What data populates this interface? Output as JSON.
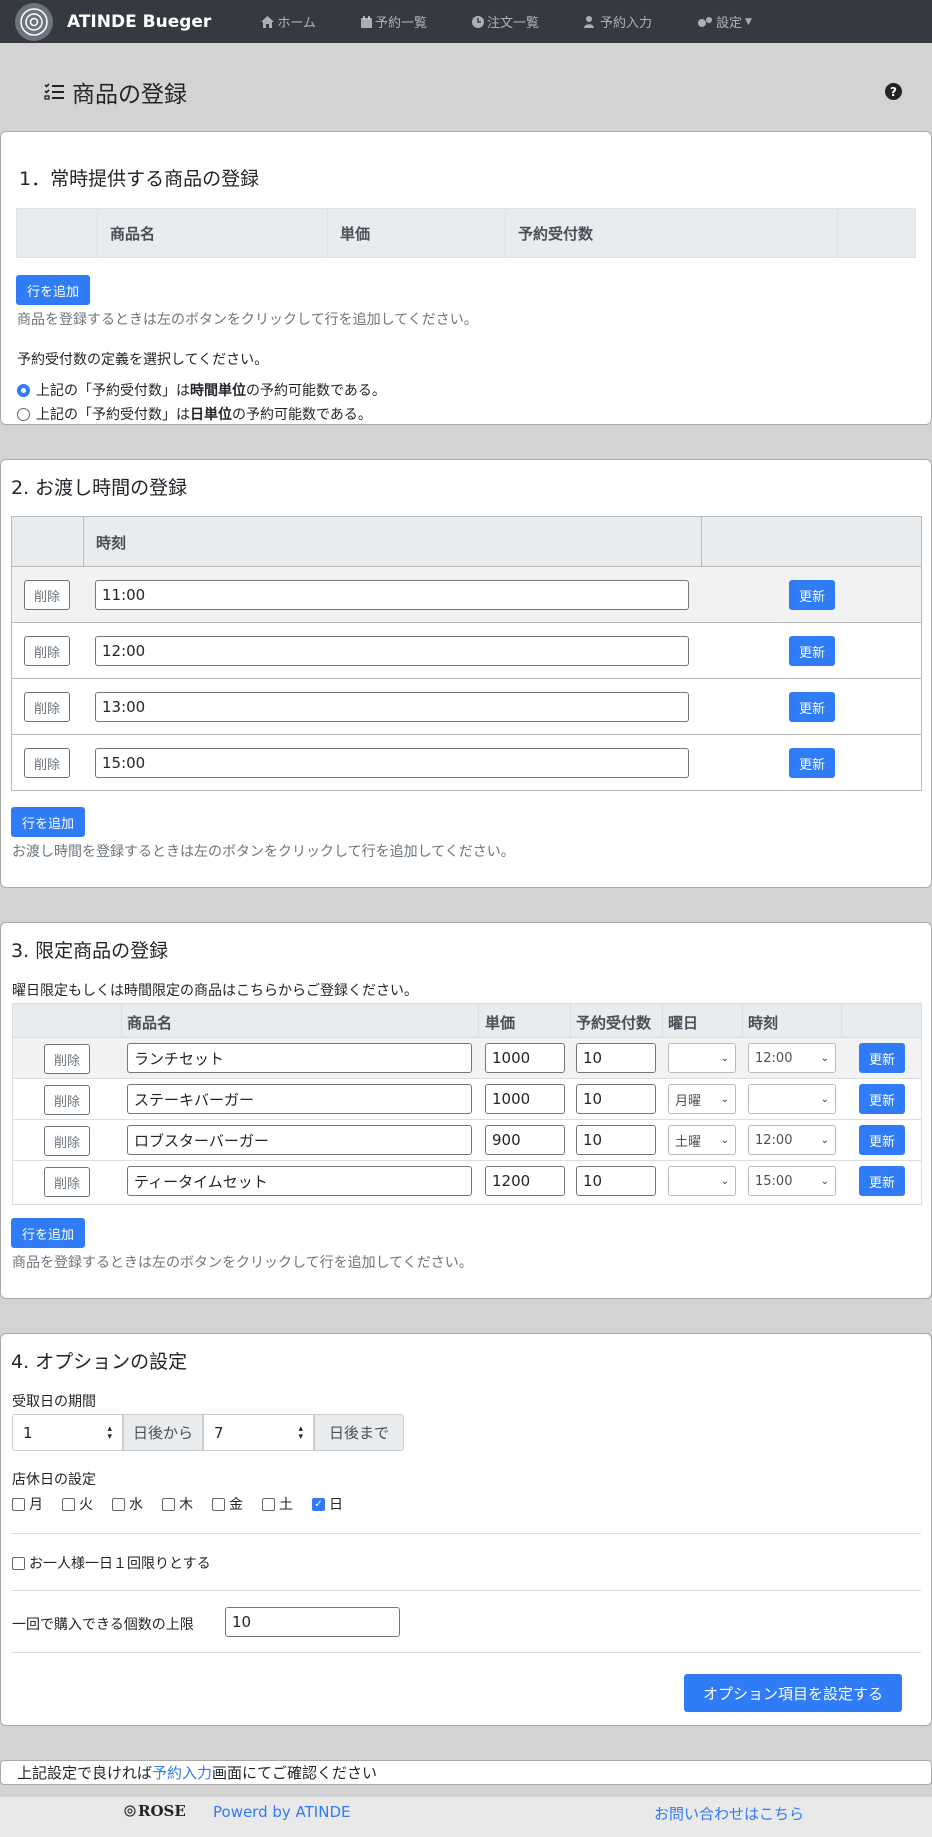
{
  "nav": {
    "brand": "ATINDE Bueger",
    "items": [
      {
        "label": "ホーム",
        "icon": "home-icon"
      },
      {
        "label": "予約一覧",
        "icon": "calendar-icon"
      },
      {
        "label": "注文一覧",
        "icon": "clock-icon"
      },
      {
        "label": "予約入力",
        "icon": "user-edit-icon"
      },
      {
        "label": "設定",
        "icon": "gears-icon"
      }
    ]
  },
  "page": {
    "title": "商品の登録"
  },
  "section1": {
    "title": "1．常時提供する商品の登録",
    "headers": [
      "商品名",
      "単価",
      "予約受付数"
    ],
    "add_label": "行を追加",
    "help": "商品を登録するときは左のボタンをクリックして行を追加してください。",
    "def_label": "予約受付数の定義を選択してください。",
    "radio1": {
      "pre": "上記の「予約受付数」は",
      "bold": "時間単位",
      "post": "の予約可能数である。"
    },
    "radio2": {
      "pre": "上記の「予約受付数」は",
      "bold": "日単位",
      "post": "の予約可能数である。"
    }
  },
  "section2": {
    "title": "2. お渡し時間の登録",
    "header": "時刻",
    "delete_label": "削除",
    "update_label": "更新",
    "times": [
      "11:00",
      "12:00",
      "13:00",
      "15:00"
    ],
    "add_label": "行を追加",
    "help": "お渡し時間を登録するときは左のボタンをクリックして行を追加してください。"
  },
  "section3": {
    "title": "3. 限定商品の登録",
    "intro": "曜日限定もしくは時間限定の商品はこちらからご登録ください。",
    "headers": [
      "商品名",
      "単価",
      "予約受付数",
      "曜日",
      "時刻"
    ],
    "delete_label": "削除",
    "update_label": "更新",
    "rows": [
      {
        "name": "ランチセット",
        "price": "1000",
        "qty": "10",
        "day": "",
        "time": "12:00"
      },
      {
        "name": "ステーキバーガー",
        "price": "1000",
        "qty": "10",
        "day": "月曜",
        "time": ""
      },
      {
        "name": "ロブスターバーガー",
        "price": "900",
        "qty": "10",
        "day": "土曜",
        "time": "12:00"
      },
      {
        "name": "ティータイムセット",
        "price": "1200",
        "qty": "10",
        "day": "",
        "time": "15:00"
      }
    ],
    "add_label": "行を追加",
    "help": "商品を登録するときは左のボタンをクリックして行を追加してください。"
  },
  "section4": {
    "title": "4. オプションの設定",
    "pickup_label": "受取日の期間",
    "from_value": "1",
    "from_suffix": "日後から",
    "to_value": "7",
    "to_suffix": "日後まで",
    "closed_label": "店休日の設定",
    "days": [
      {
        "label": "月",
        "checked": false
      },
      {
        "label": "火",
        "checked": false
      },
      {
        "label": "水",
        "checked": false
      },
      {
        "label": "木",
        "checked": false
      },
      {
        "label": "金",
        "checked": false
      },
      {
        "label": "土",
        "checked": false
      },
      {
        "label": "日",
        "checked": true
      }
    ],
    "once_label": "お一人様一日１回限りとする",
    "limit_label": "一回で購入できる個数の上限",
    "limit_value": "10",
    "submit_label": "オプション項目を設定する"
  },
  "notice": {
    "pre": "上記設定で良ければ",
    "link": "予約入力",
    "post": "画面にてご確認ください"
  },
  "footer": {
    "rose": "ROSE",
    "powered": "Powerd by ATINDE",
    "contact": "お問い合わせはこちら"
  },
  "colors": {
    "primary": "#2f7cf6",
    "navbar": "#343a40",
    "background": "#d3d3d3"
  }
}
